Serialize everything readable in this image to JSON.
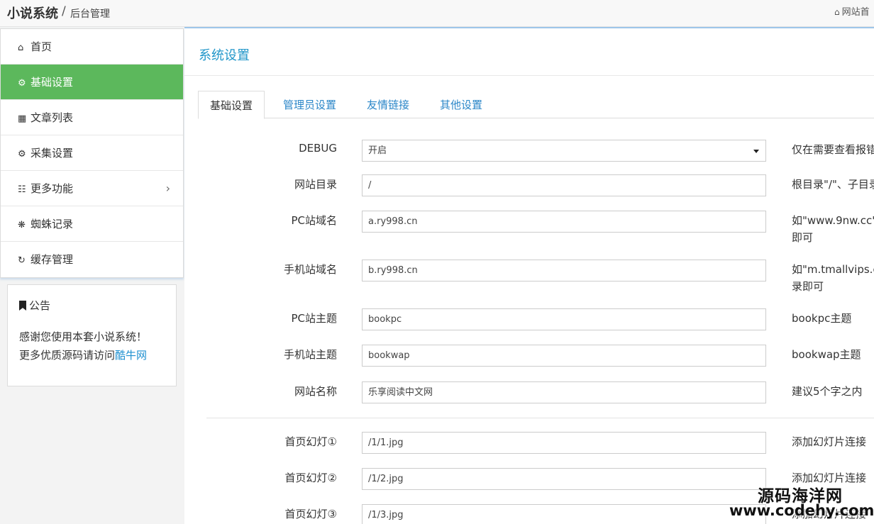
{
  "header": {
    "brand": "小说系统",
    "separator": "/",
    "subtitle": "后台管理",
    "home_link": "网站首"
  },
  "sidebar": {
    "items": [
      {
        "label": "首页",
        "icon": "home-icon"
      },
      {
        "label": "基础设置",
        "icon": "gear-icon"
      },
      {
        "label": "文章列表",
        "icon": "table-icon"
      },
      {
        "label": "采集设置",
        "icon": "gears-icon"
      },
      {
        "label": "更多功能",
        "icon": "sitemap-icon"
      },
      {
        "label": "蜘蛛记录",
        "icon": "bug-icon"
      },
      {
        "label": "缓存管理",
        "icon": "retweet-icon"
      }
    ],
    "active_color": "#5cb85c"
  },
  "notice": {
    "title": "公告",
    "line1": "感谢您使用本套小说系统！",
    "line2_prefix": "更多优质源码请访问",
    "line2_link": "酷牛网"
  },
  "main": {
    "title": "系统设置",
    "tabs": [
      "基础设置",
      "管理员设置",
      "友情链接",
      "其他设置"
    ],
    "fields": [
      {
        "label": "DEBUG",
        "value": "开启",
        "help": "仅在需要查看报错"
      },
      {
        "label": "网站目录",
        "value": "/",
        "help": "根目录\"/\"、子目录"
      },
      {
        "label": "PC站域名",
        "value": "a.ry998.cn",
        "help": "如\"www.9nw.cc\"",
        "help2": "即可"
      },
      {
        "label": "手机站域名",
        "value": "b.ry998.cn",
        "help": "如\"m.tmallvips.co",
        "help2": "录即可"
      },
      {
        "label": "PC站主题",
        "value": "bookpc",
        "help": "bookpc主题"
      },
      {
        "label": "手机站主题",
        "value": "bookwap",
        "help": "bookwap主题"
      },
      {
        "label": "网站名称",
        "value": "乐享阅读中文网",
        "help": "建议5个字之内"
      },
      {
        "label": "首页幻灯①",
        "value": "/1/1.jpg",
        "help": "添加幻灯片连接"
      },
      {
        "label": "首页幻灯②",
        "value": "/1/2.jpg",
        "help": "添加幻灯片连接"
      },
      {
        "label": "首页幻灯③",
        "value": "/1/3.jpg",
        "help": "添加幻灯片连接"
      }
    ]
  },
  "watermark": {
    "line1": "源码海洋网",
    "line2": "www.codehy.com"
  }
}
